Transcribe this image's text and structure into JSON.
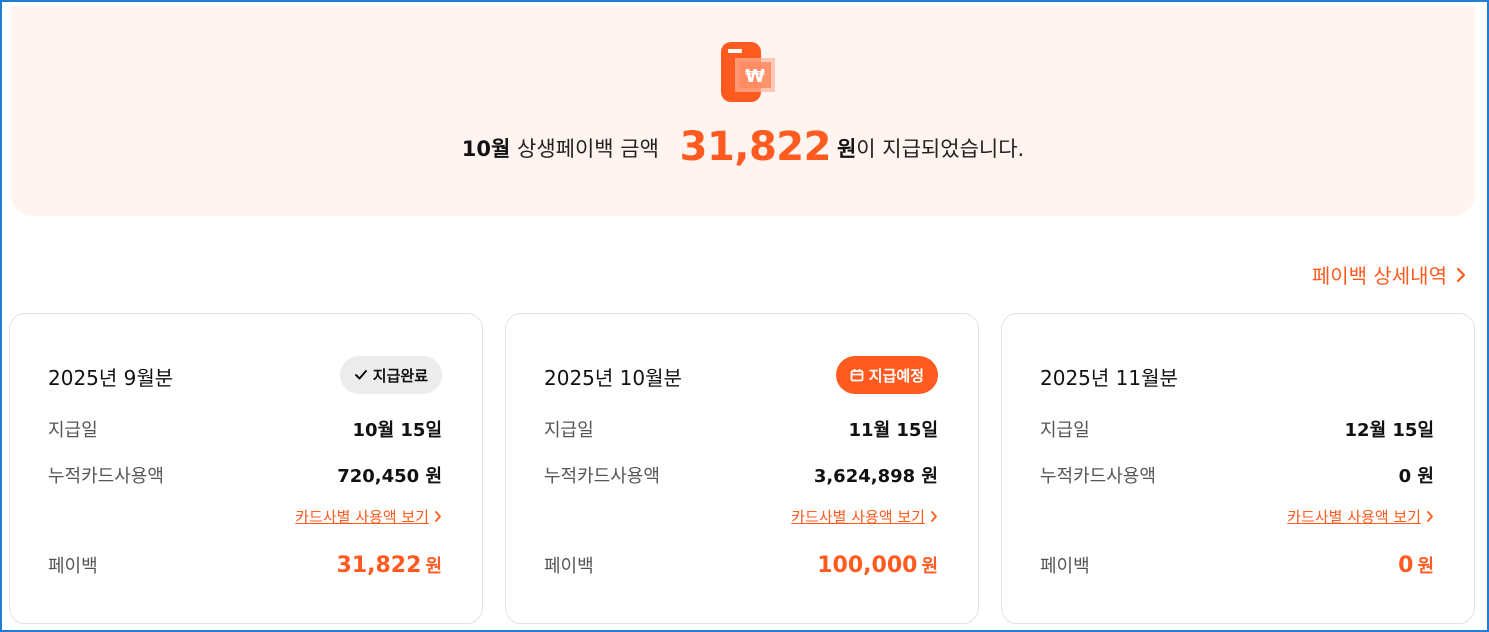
{
  "banner": {
    "month": "10월",
    "text_before": "상생페이백 금액",
    "amount": "31,822",
    "unit": "원",
    "text_after": "이 지급되었습니다.",
    "icon": "payback-won-icon",
    "accent": "#ff5a1f"
  },
  "detail_link": {
    "label": "페이백 상세내역"
  },
  "cards": [
    {
      "title": "2025년 9월분",
      "badge": "지급완료",
      "badge_icon": "check-icon",
      "pay_date_label": "지급일",
      "pay_date": "10월 15일",
      "usage_label": "누적카드사용액",
      "usage": "720,450 원",
      "card_link": "카드사별 사용액 보기",
      "payback_label": "페이백",
      "payback": "31,822",
      "payback_unit": "원"
    },
    {
      "title": "2025년 10월분",
      "badge": "지급예정",
      "badge_icon": "calendar-icon",
      "pay_date_label": "지급일",
      "pay_date": "11월 15일",
      "usage_label": "누적카드사용액",
      "usage": "3,624,898 원",
      "card_link": "카드사별 사용액 보기",
      "payback_label": "페이백",
      "payback": "100,000",
      "payback_unit": "원"
    },
    {
      "title": "2025년 11월분",
      "badge": "",
      "pay_date_label": "지급일",
      "pay_date": "12월 15일",
      "usage_label": "누적카드사용액",
      "usage": "0 원",
      "card_link": "카드사별 사용액 보기",
      "payback_label": "페이백",
      "payback": "0",
      "payback_unit": "원"
    }
  ]
}
